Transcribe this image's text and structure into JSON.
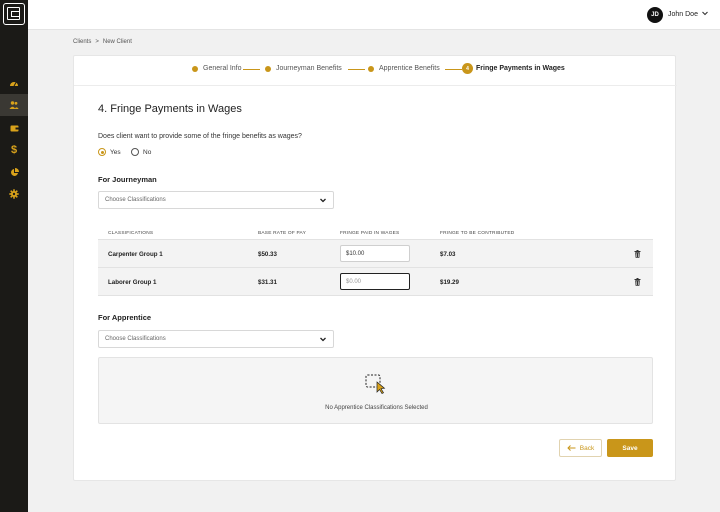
{
  "user": {
    "initials": "JD",
    "name": "John Doe"
  },
  "breadcrumb": {
    "parent": "Clients",
    "separator": ">",
    "current": "New Client"
  },
  "stepper": {
    "steps": [
      {
        "label": "General Info"
      },
      {
        "label": "Journeyman Benefits"
      },
      {
        "label": "Apprentice Benefits"
      },
      {
        "number": "4",
        "label": "Fringe Payments in Wages"
      }
    ]
  },
  "page": {
    "title": "4. Fringe Payments in Wages",
    "question": "Does client want to provide some of the fringe benefits as wages?",
    "options": {
      "yes": "Yes",
      "no": "No",
      "selected": "Yes"
    }
  },
  "journeyman": {
    "title": "For Journeyman",
    "select_placeholder": "Choose Classifications",
    "columns": [
      "Classifications",
      "Base Rate of Pay",
      "Fringe Paid in Wages",
      "Fringe to be Contributed"
    ],
    "rows": [
      {
        "classification": "Carpenter Group 1",
        "base_rate": "$50.33",
        "fringe_paid": "$10.00",
        "fringe_contributed": "$7.03"
      },
      {
        "classification": "Laborer Group 1",
        "base_rate": "$31.31",
        "fringe_paid": "$0.00",
        "fringe_contributed": "$19.29"
      }
    ]
  },
  "apprentice": {
    "title": "For Apprentice",
    "select_placeholder": "Choose Classifications",
    "empty_message": "No Apprentice Classifications Selected"
  },
  "actions": {
    "back": "Back",
    "save": "Save"
  },
  "colors": {
    "accent": "#c9961a",
    "sidebar": "#1b1a17"
  },
  "sidebar_icons": [
    "dashboard-icon",
    "users-icon",
    "wallet-icon",
    "dollar-icon",
    "pie-chart-icon",
    "gear-icon"
  ]
}
